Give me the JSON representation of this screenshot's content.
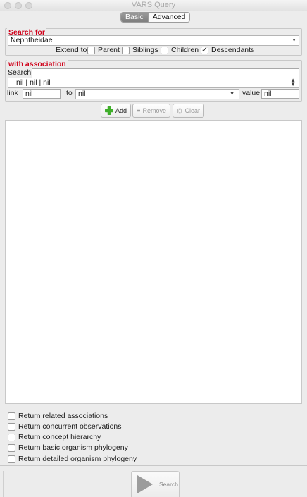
{
  "window": {
    "title": "VARS Query"
  },
  "tabs": [
    {
      "label": "Basic",
      "active": true
    },
    {
      "label": "Advanced",
      "active": false
    }
  ],
  "search_for": {
    "title": "Search for",
    "concept": "Nephtheidae",
    "extend_to_label": "Extend to",
    "options": [
      {
        "label": "Parent",
        "checked": false
      },
      {
        "label": "Siblings",
        "checked": false
      },
      {
        "label": "Children",
        "checked": false
      },
      {
        "label": "Descendants",
        "checked": true
      }
    ]
  },
  "association": {
    "title": "with association",
    "search_label": "Search:",
    "search_value": "",
    "selected": "nil | nil | nil",
    "link_label": "link",
    "link_value": "nil",
    "to_label": "to",
    "to_value": "nil",
    "value_label": "value",
    "value_value": "nil"
  },
  "actions": {
    "add": "Add",
    "remove": "Remove",
    "clear": "Clear"
  },
  "return_options": [
    {
      "label": "Return related associations",
      "checked": false
    },
    {
      "label": "Return concurrent observations",
      "checked": false
    },
    {
      "label": "Return concept hierarchy",
      "checked": false
    },
    {
      "label": "Return basic organism phylogeny",
      "checked": false
    },
    {
      "label": "Return detailed organism phylogeny",
      "checked": false
    }
  ],
  "search_button": {
    "label": "Search"
  },
  "colors": {
    "section_title": "#d0021b",
    "add_icon": "#3fae2a"
  }
}
